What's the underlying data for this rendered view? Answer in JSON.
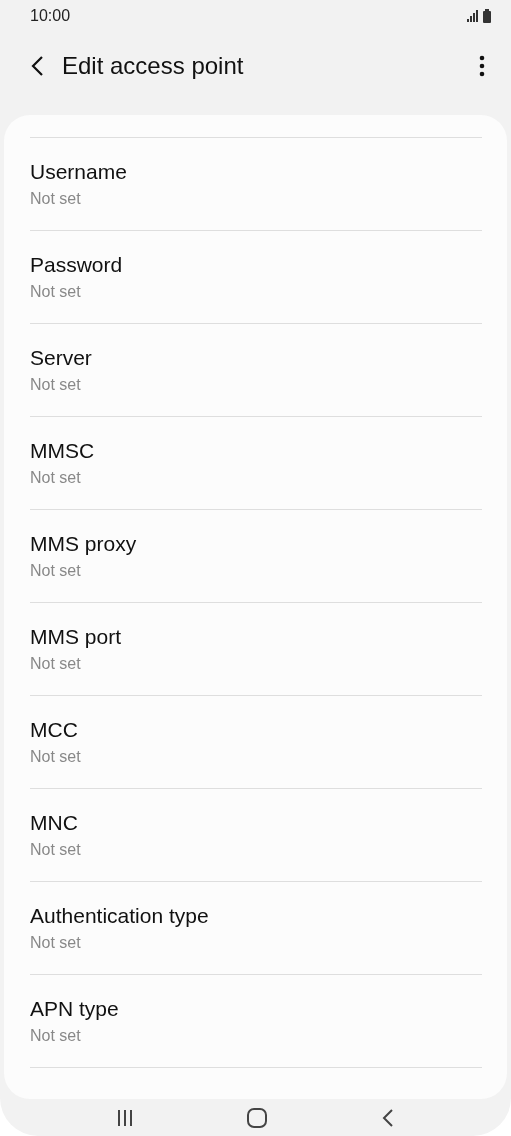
{
  "status_bar": {
    "time": "10:00"
  },
  "header": {
    "title": "Edit access point"
  },
  "fields": [
    {
      "label": "Username",
      "value": "Not set"
    },
    {
      "label": "Password",
      "value": "Not set"
    },
    {
      "label": "Server",
      "value": "Not set"
    },
    {
      "label": "MMSC",
      "value": "Not set"
    },
    {
      "label": "MMS proxy",
      "value": "Not set"
    },
    {
      "label": "MMS port",
      "value": "Not set"
    },
    {
      "label": "MCC",
      "value": "Not set"
    },
    {
      "label": "MNC",
      "value": "Not set"
    },
    {
      "label": "Authentication type",
      "value": "Not set"
    },
    {
      "label": "APN type",
      "value": "Not set"
    }
  ]
}
